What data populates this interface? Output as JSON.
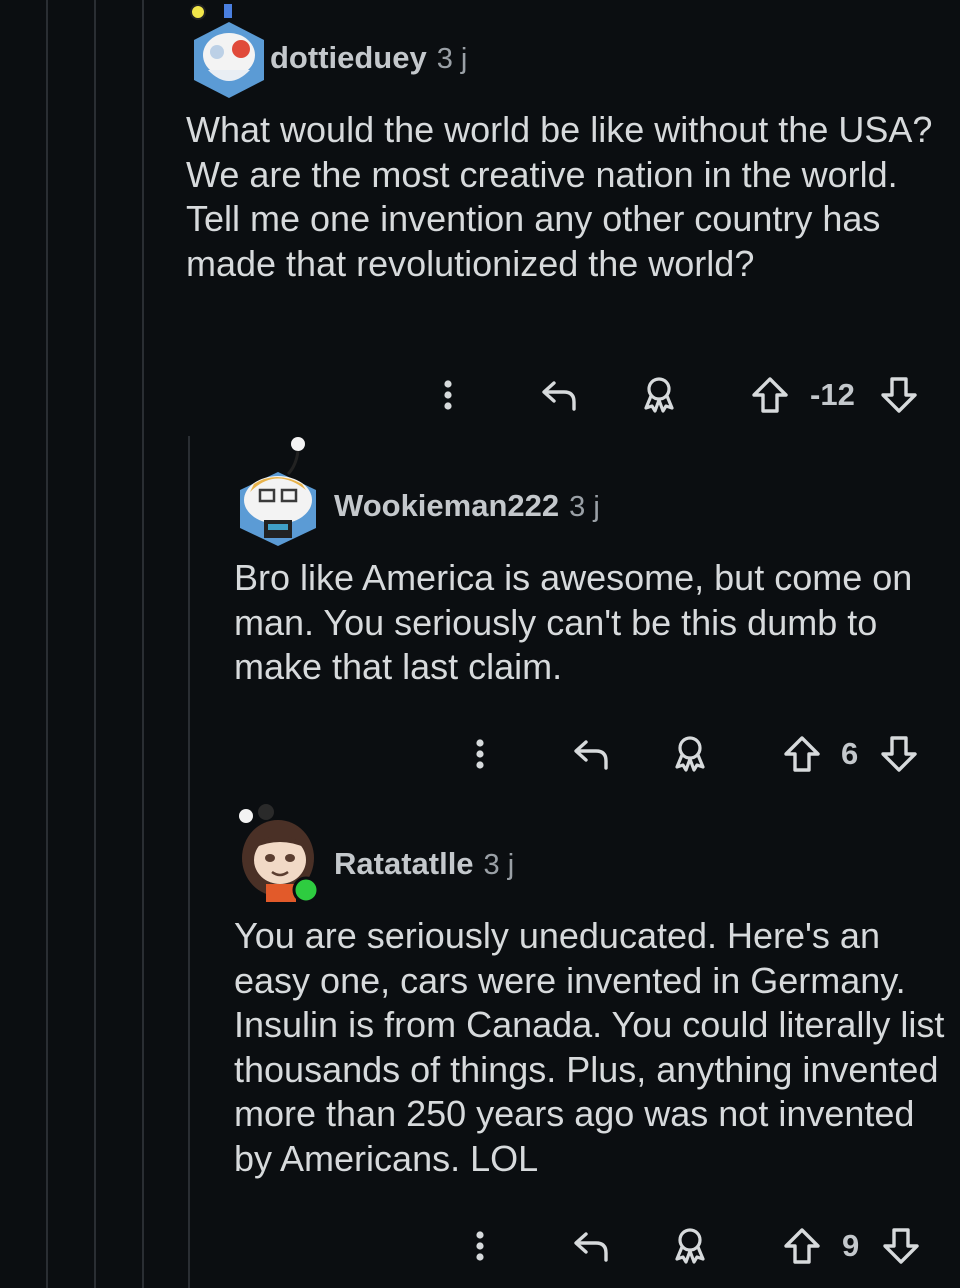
{
  "colors": {
    "background": "#0b0e11",
    "text": "#d7dadc",
    "muted": "#9aa0a6",
    "thread_line": "#2a2e33",
    "online_dot": "#2ecc40"
  },
  "comments": [
    {
      "username": "dottieduey",
      "age": "3 j",
      "text": "What would the world be like without the USA? We are the most creative nation in the world. Tell me one invention any other country has made that revolutionized the world?",
      "score": "-12",
      "icons": [
        "more-vertical-icon",
        "reply-icon",
        "award-icon",
        "upvote-icon",
        "downvote-icon"
      ]
    },
    {
      "username": "Wookieman222",
      "age": "3 j",
      "text": "Bro like America is awesome, but come on man. You seriously can't be this dumb to make that last claim.",
      "score": "6",
      "icons": [
        "more-vertical-icon",
        "reply-icon",
        "award-icon",
        "upvote-icon",
        "downvote-icon"
      ]
    },
    {
      "username": "Ratatatlle",
      "age": "3 j",
      "text": "You are seriously uneducated. Here's an easy one, cars were invented in Germany. Insulin is from Canada. You could literally list thousands of things. Plus, anything invented more than 250 years ago was not invented by Americans. LOL",
      "score": "9",
      "icons": [
        "more-vertical-icon",
        "reply-icon",
        "award-icon",
        "upvote-icon",
        "downvote-icon"
      ]
    }
  ]
}
